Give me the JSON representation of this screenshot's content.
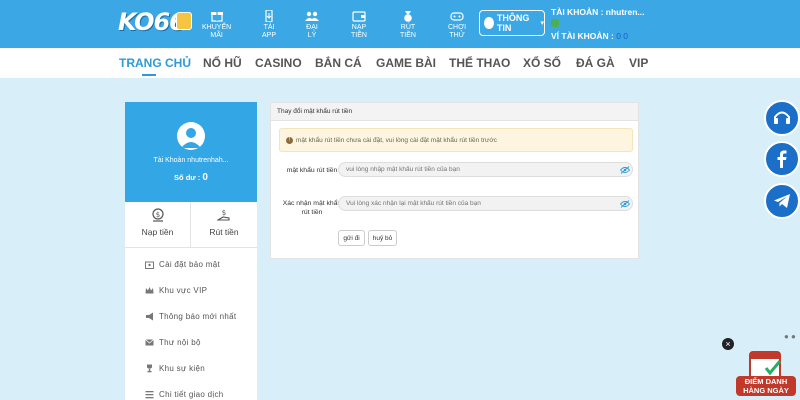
{
  "header": {
    "logo": "KO66",
    "nav": [
      {
        "label": "KHUYẾN\nMÃI",
        "icon": "gift-icon"
      },
      {
        "label": "TẢI\nAPP",
        "icon": "download-app-icon"
      },
      {
        "label": "ĐẠI\nLÝ",
        "icon": "agent-icon"
      },
      {
        "label": "NẠP\nTIỀN",
        "icon": "deposit-icon"
      },
      {
        "label": "RÚT\nTIỀN",
        "icon": "withdraw-icon"
      },
      {
        "label": "CHƠI\nTHỬ",
        "icon": "gamepad-icon"
      }
    ],
    "info_button": "THÔNG TIN",
    "account_label": "TÀI KHOẢN : nhutren...",
    "wallet_label": "VÍ TÀI KHOẢN :",
    "wallet_value": "0 0"
  },
  "mainnav": [
    "TRANG CHỦ",
    "NỔ HŨ",
    "CASINO",
    "BẮN CÁ",
    "GAME BÀI",
    "THỂ THAO",
    "XỔ SỐ",
    "ĐÁ GÀ",
    "VIP"
  ],
  "profile": {
    "name": "Tài Khoản nhutrenhah...",
    "balance_label": "Số dư : ",
    "balance_value": "0"
  },
  "actions": {
    "deposit": "Nạp tiền",
    "withdraw": "Rút tiền"
  },
  "menu": [
    {
      "label": "Cài đặt bảo mật",
      "icon": "security-settings-icon"
    },
    {
      "label": "Khu vực VIP",
      "icon": "crown-icon"
    },
    {
      "label": "Thông báo mới nhất",
      "icon": "megaphone-icon"
    },
    {
      "label": "Thư nội bộ",
      "icon": "mail-icon"
    },
    {
      "label": "Khu sự kiện",
      "icon": "trophy-icon"
    },
    {
      "label": "Chi tiết giao dịch",
      "icon": "list-icon"
    }
  ],
  "panel": {
    "title": "Thay đổi mật khẩu rút tiền",
    "warning": "mật khẩu rút tiền chưa cài đặt, vui lòng cài đặt mật khẩu rút tiền trước",
    "field1_label": "mật khẩu rút tiền",
    "field1_placeholder": "vui lòng nhập mật khẩu rút tiền của bạn",
    "field2_label": "Xác nhận mật khẩu rút tiền",
    "field2_placeholder": "Vui lòng xác nhận lại mật khẩu rút tiền của bạn",
    "submit": "gửi đi",
    "cancel": "huỷ bỏ"
  },
  "floating": {
    "badge_text": "ĐIỂM DANH\nHÀNG NGÀY",
    "close": "×"
  },
  "colors": {
    "header": "#3ba8e5",
    "accent": "#2e9ad8",
    "profile": "#33a6e6",
    "background": "#d8eef8"
  }
}
